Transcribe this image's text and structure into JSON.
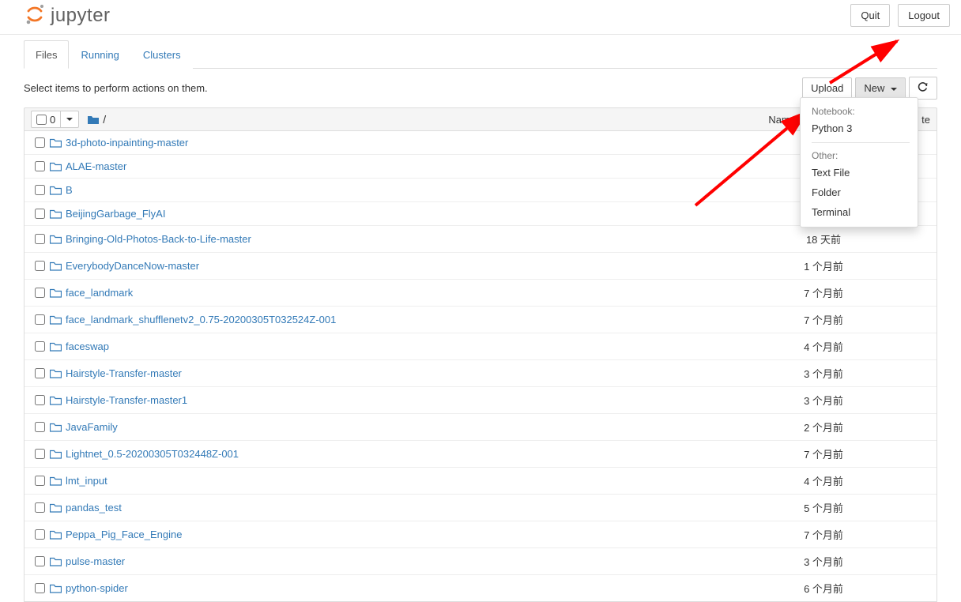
{
  "header": {
    "logo_text": "jupyter",
    "quit_label": "Quit",
    "logout_label": "Logout"
  },
  "tabs": {
    "files": "Files",
    "running": "Running",
    "clusters": "Clusters"
  },
  "toolbar": {
    "instruction": "Select items to perform actions on them.",
    "upload_label": "Upload",
    "new_label": "New",
    "select_count": "0",
    "breadcrumb_root": "/"
  },
  "columns": {
    "name": "Name",
    "last_modified_short": "te"
  },
  "new_menu": {
    "notebook_label": "Notebook:",
    "python3": "Python 3",
    "other_label": "Other:",
    "text_file": "Text File",
    "folder": "Folder",
    "terminal": "Terminal"
  },
  "items": [
    {
      "name": "3d-photo-inpainting-master",
      "modified": ""
    },
    {
      "name": "ALAE-master",
      "modified": ""
    },
    {
      "name": "B",
      "modified": ""
    },
    {
      "name": "BeijingGarbage_FlyAI",
      "modified": ""
    },
    {
      "name": "Bringing-Old-Photos-Back-to-Life-master",
      "modified": "18 天前"
    },
    {
      "name": "EverybodyDanceNow-master",
      "modified": "1 个月前"
    },
    {
      "name": "face_landmark",
      "modified": "7 个月前"
    },
    {
      "name": "face_landmark_shufflenetv2_0.75-20200305T032524Z-001",
      "modified": "7 个月前"
    },
    {
      "name": "faceswap",
      "modified": "4 个月前"
    },
    {
      "name": "Hairstyle-Transfer-master",
      "modified": "3 个月前"
    },
    {
      "name": "Hairstyle-Transfer-master1",
      "modified": "3 个月前"
    },
    {
      "name": "JavaFamily",
      "modified": "2 个月前"
    },
    {
      "name": "Lightnet_0.5-20200305T032448Z-001",
      "modified": "7 个月前"
    },
    {
      "name": "lmt_input",
      "modified": "4 个月前"
    },
    {
      "name": "pandas_test",
      "modified": "5 个月前"
    },
    {
      "name": "Peppa_Pig_Face_Engine",
      "modified": "7 个月前"
    },
    {
      "name": "pulse-master",
      "modified": "3 个月前"
    },
    {
      "name": "python-spider",
      "modified": "6 个月前"
    }
  ]
}
